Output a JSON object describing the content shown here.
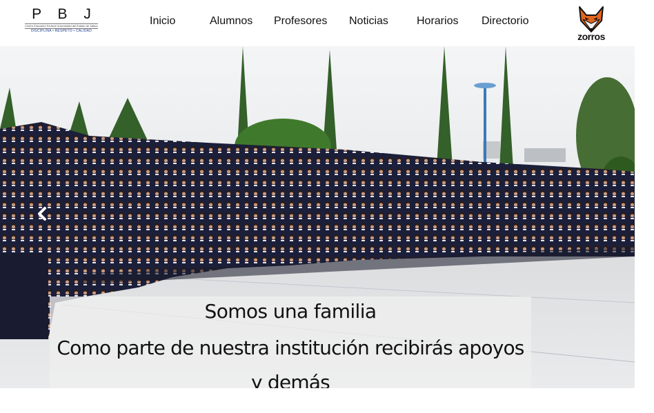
{
  "header": {
    "logo": {
      "letters": "P B J",
      "subtitle": "Centro Educativo Federal Universidad del Estado de Jalisco",
      "motto": "DISCIPLINA • RESPETO • CALIDAD"
    },
    "nav": [
      {
        "label": "Inicio"
      },
      {
        "label": "Alumnos"
      },
      {
        "label": "Profesores"
      },
      {
        "label": "Noticias"
      },
      {
        "label": "Horarios"
      },
      {
        "label": "Directorio"
      }
    ],
    "mascot": {
      "word": "zorros",
      "icon": "fox-mascot-icon"
    }
  },
  "carousel": {
    "prev_icon": "chevron-left-icon",
    "caption": {
      "title": "Somos una familia",
      "text": "Como parte de nuestra institución recibirás apoyos y demás"
    }
  },
  "colors": {
    "uniform": "#1c1f3a",
    "sky": "#eef0f1",
    "ground": "#dfe1e3",
    "tree": "#2f5a1f",
    "fox": "#e2651e"
  }
}
